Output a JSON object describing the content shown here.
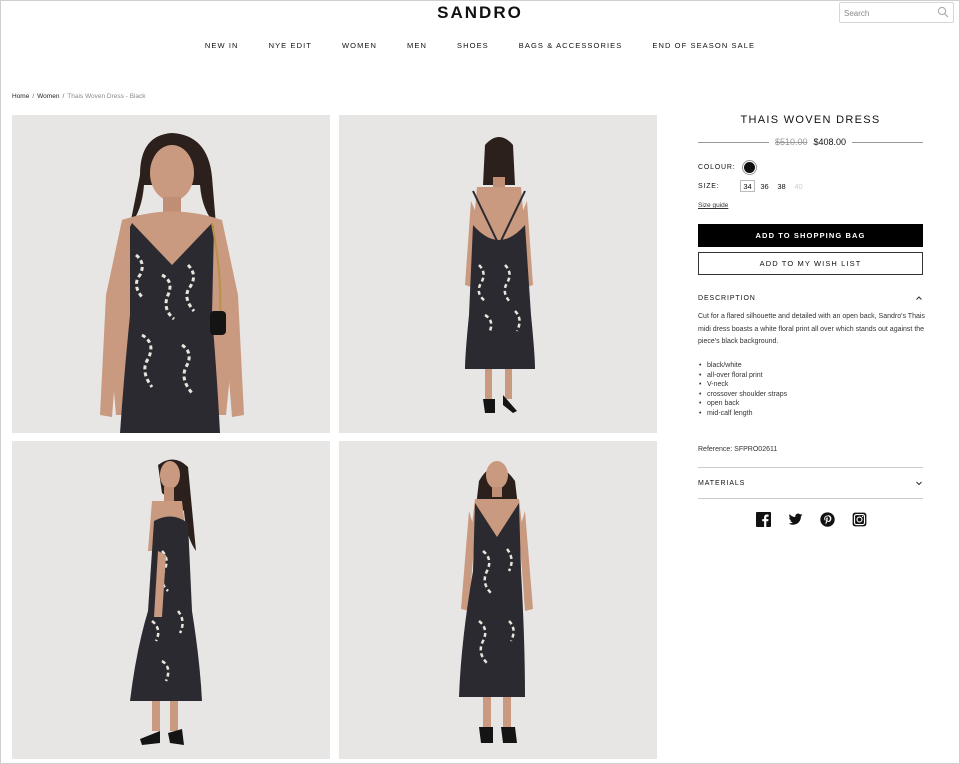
{
  "brand": {
    "logo": "SANDRO"
  },
  "search": {
    "placeholder": "Search",
    "icon": "search-icon"
  },
  "nav": [
    {
      "label": "NEW IN"
    },
    {
      "label": "NYE EDIT"
    },
    {
      "label": "WOMEN"
    },
    {
      "label": "MEN"
    },
    {
      "label": "SHOES"
    },
    {
      "label": "BAGS & ACCESSORIES"
    },
    {
      "label": "END OF SEASON SALE"
    }
  ],
  "breadcrumb": {
    "home": "Home",
    "women": "Women",
    "current": "Thais Woven Dress - Black",
    "separator": "/"
  },
  "gallery": {
    "photos": [
      {
        "name": "front-closeup-photo"
      },
      {
        "name": "back-view-photo"
      },
      {
        "name": "side-view-photo"
      },
      {
        "name": "front-full-photo"
      }
    ]
  },
  "product": {
    "title": "THAIS WOVEN DRESS",
    "old_price": "$510.00",
    "new_price": "$408.00",
    "colour_label": "COLOUR:",
    "colour_value": "#111111",
    "size_label": "SIZE:",
    "sizes": [
      {
        "label": "34",
        "state": "selected"
      },
      {
        "label": "36",
        "state": "available"
      },
      {
        "label": "38",
        "state": "available"
      },
      {
        "label": "40",
        "state": "unavailable"
      }
    ],
    "size_guide": "Size guide",
    "add_to_bag": "ADD TO SHOPPING BAG",
    "add_to_wishlist": "ADD TO MY WISH LIST"
  },
  "description": {
    "heading": "DESCRIPTION",
    "text": "Cut for a flared silhouette and detailed with an open back, Sandro's Thais midi dress boasts a white floral print all over which stands out against the piece's black background.",
    "bullets": [
      "black/white",
      "all-over floral print",
      "V-neck",
      "crossover shoulder straps",
      "open back",
      "mid-calf length"
    ],
    "reference": "Reference: SFPRO02611"
  },
  "materials": {
    "heading": "MATERIALS"
  },
  "social": [
    "facebook-icon",
    "twitter-icon",
    "pinterest-icon",
    "instagram-icon"
  ],
  "colors": {
    "accent": "#000000",
    "background": "#ffffff",
    "photo_bg": "#e7e6e4"
  }
}
